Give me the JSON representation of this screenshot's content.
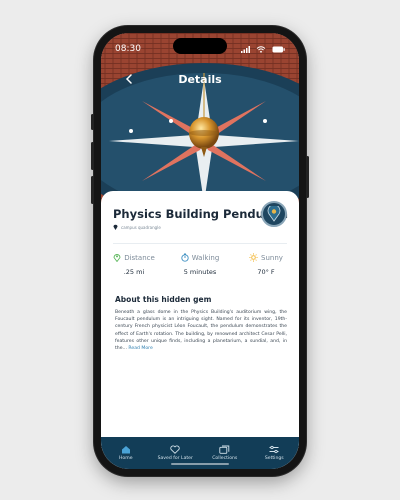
{
  "status_bar": {
    "time": "08:30"
  },
  "header": {
    "title": "Details"
  },
  "place": {
    "name": "Physics Building Pendulum",
    "location": "campus quadrangle"
  },
  "stats": [
    {
      "label": "Distance",
      "value": ".25 mi",
      "icon": "location-pin-icon",
      "color": "#5db85d"
    },
    {
      "label": "Walking",
      "value": "5 minutes",
      "icon": "stopwatch-icon",
      "color": "#3d8fc2"
    },
    {
      "label": "Sunny",
      "value": "70° F",
      "icon": "sun-icon",
      "color": "#f2b531"
    }
  ],
  "about": {
    "title": "About this hidden gem",
    "text": "Beneath a glass dome in the Physics Building's auditorium wing, the Foucault pendulum is an intriguing sight. Named for its inventor, 19th-century French physicist Léon Foucault, the pendulum demonstrates the effect of Earth's rotation. The building, by renowned architect Cesar Pelli, features other unique finds, including a planetarium, a sundial, and, in the...",
    "read_more": "Read More"
  },
  "tabs": [
    {
      "label": "Home",
      "icon": "home-icon"
    },
    {
      "label": "Saved for Later",
      "icon": "heart-icon"
    },
    {
      "label": "Collections",
      "icon": "collections-icon"
    },
    {
      "label": "Settings",
      "icon": "sliders-icon"
    }
  ],
  "colors": {
    "tab_bar": "#123d57",
    "title_text": "#1c2a39",
    "link": "#2f7fb0"
  }
}
